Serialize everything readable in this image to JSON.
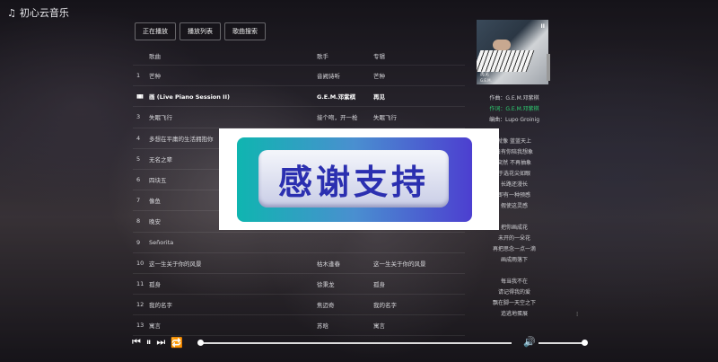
{
  "app": {
    "title": "初心云音乐",
    "icon": "music-note-icon"
  },
  "tabs": [
    {
      "label": "正在播放"
    },
    {
      "label": "播放列表"
    },
    {
      "label": "歌曲搜索"
    }
  ],
  "table": {
    "headers": {
      "title": "歌曲",
      "artist": "歌手",
      "album": "专辑"
    },
    "rows": [
      {
        "num": "1",
        "title": "芒种",
        "artist": "音阙诗听",
        "album": "芒种"
      },
      {
        "num": "",
        "title": "画 (Live Piano Session II)",
        "artist": "G.E.M.邓紫棋",
        "album": "再见",
        "active": true
      },
      {
        "num": "3",
        "title": "失眠飞行",
        "artist": "接个吻，开一枪",
        "album": "失眠飞行"
      },
      {
        "num": "4",
        "title": "多想在平庸的生活拥抱你",
        "artist": "",
        "album": ""
      },
      {
        "num": "5",
        "title": "无名之辈",
        "artist": "",
        "album": ""
      },
      {
        "num": "6",
        "title": "四块五",
        "artist": "",
        "album": ""
      },
      {
        "num": "7",
        "title": "像鱼",
        "artist": "",
        "album": ""
      },
      {
        "num": "8",
        "title": "晚安",
        "artist": "",
        "album": ""
      },
      {
        "num": "9",
        "title": "Señorita",
        "artist": "",
        "album": ""
      },
      {
        "num": "10",
        "title": "这一生关于你的风景",
        "artist": "枯木逢春",
        "album": "这一生关于你的风景"
      },
      {
        "num": "11",
        "title": "孤身",
        "artist": "徐秉龙",
        "album": "孤身"
      },
      {
        "num": "12",
        "title": "我的名字",
        "artist": "焦迈奇",
        "album": "我的名字"
      },
      {
        "num": "13",
        "title": "寓言",
        "artist": "苏晗",
        "album": "寓言"
      }
    ]
  },
  "cover": {
    "label_cn": "再见",
    "label_en": "G.E.M.",
    "mark": "II"
  },
  "lyrics": [
    {
      "text": "作曲：G.E.M.邓紫棋"
    },
    {
      "text": "作词：G.E.M.邓紫棋",
      "current": true
    },
    {
      "text": "编曲：Lupo Groinig"
    },
    {
      "text": ""
    },
    {
      "text": "就像 蓝蓝天上"
    },
    {
      "text": "白有你陪我想象"
    },
    {
      "text": "突然 不再抽象"
    },
    {
      "text": "于选花尖如眼"
    },
    {
      "text": "长路还漫长"
    },
    {
      "text": "即有一种预感"
    },
    {
      "text": "假使这灵感"
    },
    {
      "text": ""
    },
    {
      "text": "把你画成花"
    },
    {
      "text": "未开的一朵花"
    },
    {
      "text": "再把思念一点一滴"
    },
    {
      "text": "画成雨落下"
    },
    {
      "text": ""
    },
    {
      "text": "每当我不在"
    },
    {
      "text": "请记得我的爱"
    },
    {
      "text": "飘在脚一天空之下"
    },
    {
      "text": "追逃地蛋展"
    }
  ],
  "overlay": {
    "text": "感谢支持"
  },
  "player": {
    "prev_icon": "skip-back-icon",
    "pause_icon": "pause-icon",
    "next_icon": "skip-forward-icon",
    "loop_icon": "repeat-icon",
    "volume_icon": "volume-icon",
    "progress": 0.0,
    "volume": 1.0
  }
}
